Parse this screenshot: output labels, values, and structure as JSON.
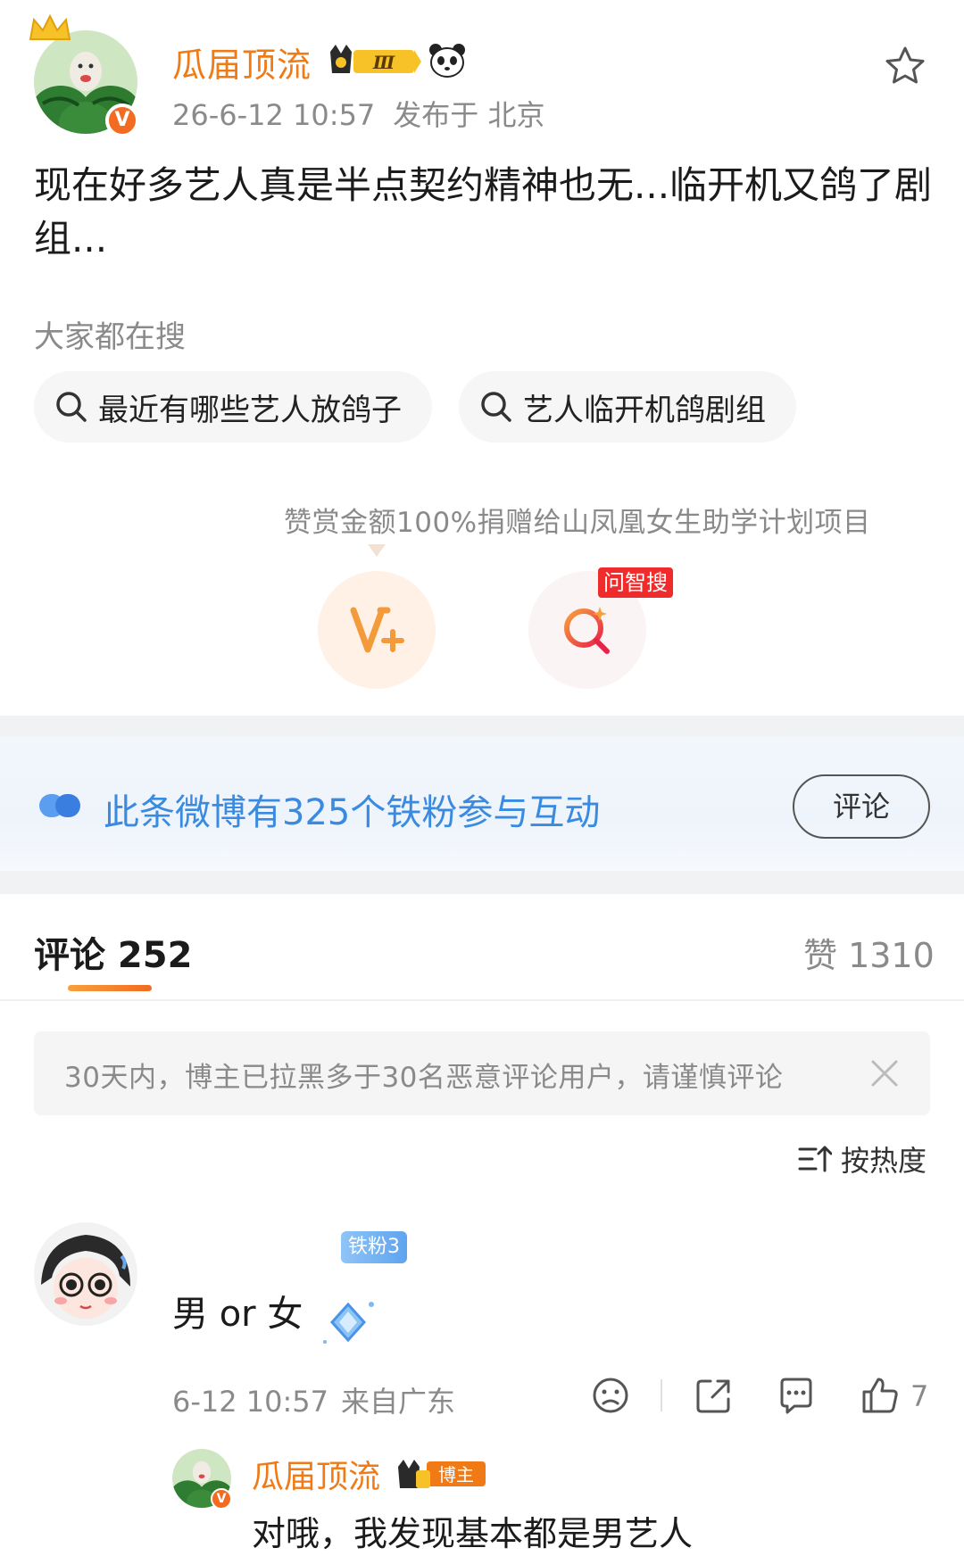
{
  "post": {
    "author_name": "瓜届顶流",
    "level_badge": "Ⅲ",
    "time": "26-6-12 10:57",
    "location": "发布于 北京",
    "text": "现在好多艺人真是半点契约精神也无...临开机又鸽了剧组..."
  },
  "search": {
    "label": "大家都在搜",
    "chips": [
      "最近有哪些艺人放鸽子",
      "艺人临开机鸽剧组"
    ]
  },
  "reward": {
    "text": "赞赏金额100%捐赠给山凤凰女生助学计划项目",
    "wenzhisou_tag": "问智搜"
  },
  "fans_band": {
    "text": "此条微博有325个铁粉参与互动",
    "button": "评论"
  },
  "comments_header": {
    "tab_label": "评论 252",
    "like_label": "赞 1310"
  },
  "notice": {
    "text": "30天内，博主已拉黑多于30名恶意评论用户，请谨慎评论"
  },
  "sort": {
    "label": "按热度"
  },
  "comment": {
    "fan_badge": "铁粉3",
    "text": "男 or 女",
    "time": "6-12 10:57",
    "location": "来自广东",
    "like_count": "7"
  },
  "reply": {
    "author_name": "瓜届顶流",
    "badge": "博主",
    "text": "对哦，我发现基本都是男艺人"
  },
  "colors": {
    "accent_orange": "#f07a16",
    "link_blue": "#3a8ae0",
    "muted": "#8a8a8a"
  }
}
